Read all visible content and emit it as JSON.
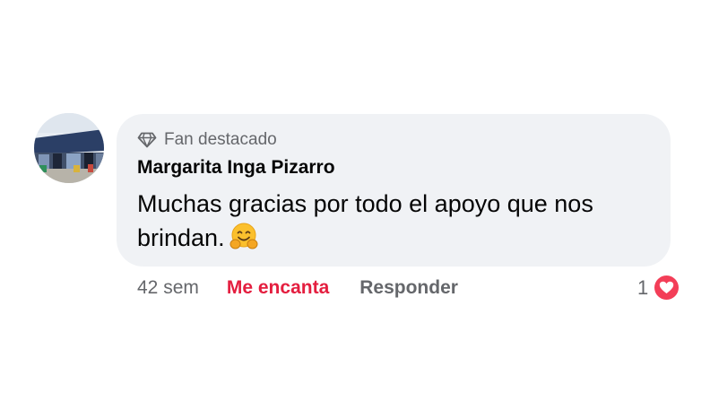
{
  "comment": {
    "badge_label": "Fan destacado",
    "badge_icon": "diamond-icon",
    "author": "Margarita Inga Pizarro",
    "text": "Muchas gracias por todo el apoyo que nos brindan.",
    "emoji": "hugging-face-emoji",
    "bubble_color": "#f0f2f5"
  },
  "actions": {
    "time": "42 sem",
    "love_label": "Me encanta",
    "reply_label": "Responder",
    "love_color": "#e41e3f"
  },
  "reactions": {
    "count": "1",
    "type": "love-reaction-icon",
    "color": "#f33e58"
  }
}
